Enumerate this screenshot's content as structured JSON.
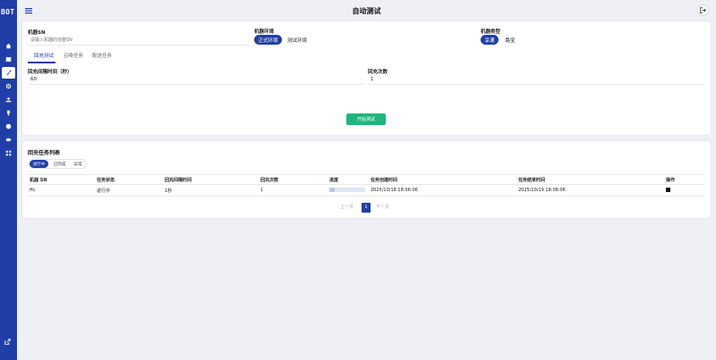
{
  "app": {
    "logo": "BOT",
    "title": "自动测试"
  },
  "sidebar": {
    "items": [
      {
        "icon": "home-icon",
        "active": false
      },
      {
        "icon": "map-icon",
        "active": false
      },
      {
        "icon": "tool-icon",
        "active": true
      },
      {
        "icon": "gear-icon",
        "active": false
      },
      {
        "icon": "upload-icon",
        "active": false
      },
      {
        "icon": "usb-icon",
        "active": false
      },
      {
        "icon": "globe-icon",
        "active": false
      },
      {
        "icon": "cloud-icon",
        "active": false
      },
      {
        "icon": "grid-icon",
        "active": false
      }
    ],
    "external_icon": "external-link-icon"
  },
  "config": {
    "sn_label": "机器SN",
    "sn_placeholder": "请输入机器的完整SN",
    "env_label": "机器环境",
    "env_options": [
      "正式环境",
      "测试环境"
    ],
    "env_selected": "正式环境",
    "type_label": "机器类型",
    "type_options": [
      "享通",
      "路宝"
    ],
    "type_selected": "享通"
  },
  "tabs": [
    "回充测试",
    "召唤任务",
    "配送任务"
  ],
  "active_tab": "回充测试",
  "form": {
    "interval_label": "回充间隔时间（秒）",
    "interval_value": "60",
    "count_label": "回充次数",
    "count_value": "1",
    "start_button": "开始测试"
  },
  "list": {
    "title": "回充任务列表",
    "filters": [
      "进行中",
      "已完成",
      "异常"
    ],
    "active_filter": "进行中",
    "columns": [
      "机器 SN",
      "任务状态",
      "回充间隔时间",
      "回充次数",
      "进度",
      "任务创建时间",
      "任务结束时间",
      "操作"
    ],
    "rows": [
      {
        "sn": "ffs",
        "status": "进行中",
        "interval": "1秒",
        "count": "1",
        "progress_text": "—",
        "progress_fraction": 0.15,
        "created": "2025/10/18 18:06:06",
        "ended": "2025/10/19 18:08:06"
      }
    ]
  },
  "pagination": {
    "prev": "上一页",
    "current": "1",
    "next": "下一页"
  }
}
